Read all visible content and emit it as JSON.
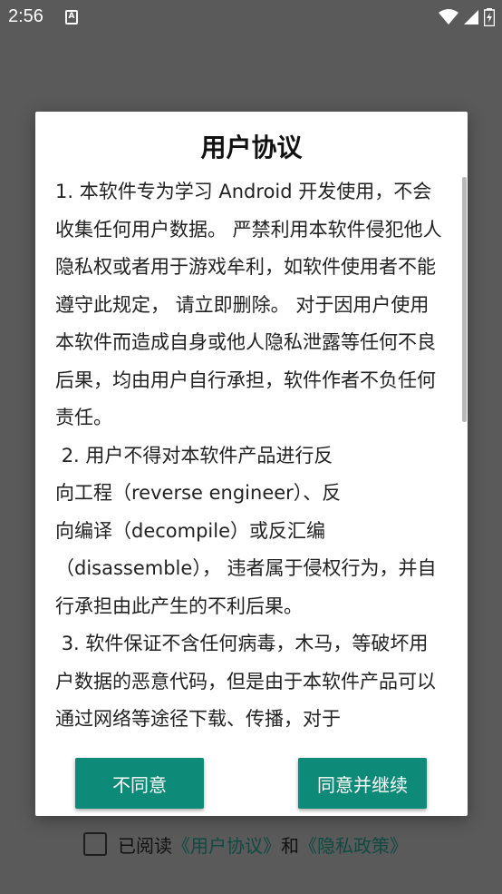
{
  "status_bar": {
    "time": "2:56",
    "notification_icon": "A"
  },
  "dialog": {
    "title": "用户协议",
    "body_text": "1. 本软件专为学习 Android 开发使用，不会收集任何用户数据。 严禁利用本软件侵犯他人隐私权或者用于游戏牟利，如软件使用者不能遵守此规定， 请立即删除。 对于因用户使用本软件而造成自身或他人隐私泄露等任何不良后果，均由用户自行承担，软件作者不负任何责任。\n 2. 用户不得对本软件产品进行反\n向工程（reverse engineer）、反\n向编译（decompile）或反汇编\n（disassemble）， 违者属于侵权行为，并自行承担由此产生的不利后果。\n 3. 软件保证不含任何病毒，木马，等破坏用户数据的恶意代码，但是由于本软件产品可以通过网络等途径下载、传播，对于",
    "decline_label": "不同意",
    "accept_label": "同意并继续"
  },
  "agreement_row": {
    "prefix": "已阅读",
    "user_agreement_link": "《用户协议》",
    "and": "和",
    "privacy_link": "《隐私政策》",
    "checked": false
  },
  "colors": {
    "accent": "#0e8a78",
    "link": "#0f4a40",
    "overlay": "#5a5a5a"
  },
  "icons": [
    "wifi-icon",
    "signal-icon",
    "battery-charging-icon"
  ]
}
